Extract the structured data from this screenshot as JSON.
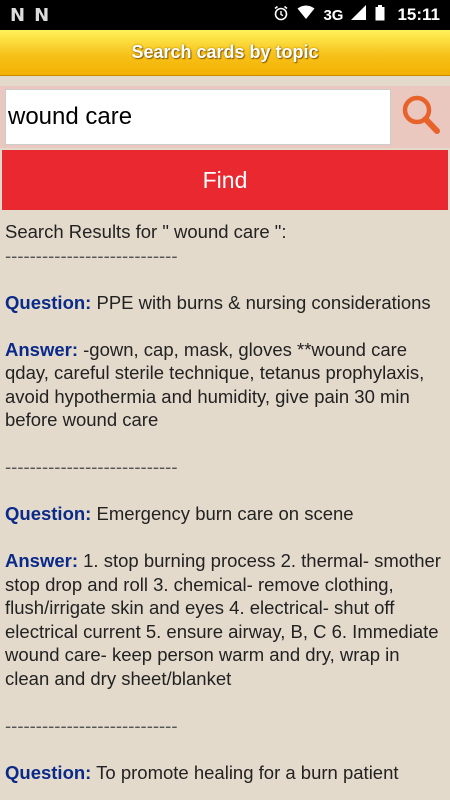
{
  "status": {
    "left_icons": [
      "n-icon",
      "n-icon"
    ],
    "network": "3G",
    "time": "15:11"
  },
  "app": {
    "title": "Search cards by topic",
    "search": {
      "value": "wound care",
      "icon": "search-icon"
    },
    "find_label": "Find"
  },
  "results": {
    "header": "Search Results for \" wound care \":",
    "separator": "----------------------------",
    "question_label": "Question:",
    "answer_label": "Answer:",
    "items": [
      {
        "question": "PPE with burns & nursing considerations",
        "answer": "-gown, cap, mask, gloves **wound care qday, careful sterile technique, tetanus prophylaxis, avoid hypothermia and humidity, give pain 30 min before wound care"
      },
      {
        "question": "Emergency burn care on scene",
        "answer": "1. stop burning process 2. thermal- smother stop drop and roll 3. chemical- remove clothing, flush/irrigate skin and eyes 4. electrical- shut off electrical current 5. ensure airway, B, C 6. Immediate wound care- keep person warm and dry, wrap in clean and dry sheet/blanket"
      },
      {
        "question": "To promote healing for a burn patient",
        "answer": ""
      }
    ]
  }
}
